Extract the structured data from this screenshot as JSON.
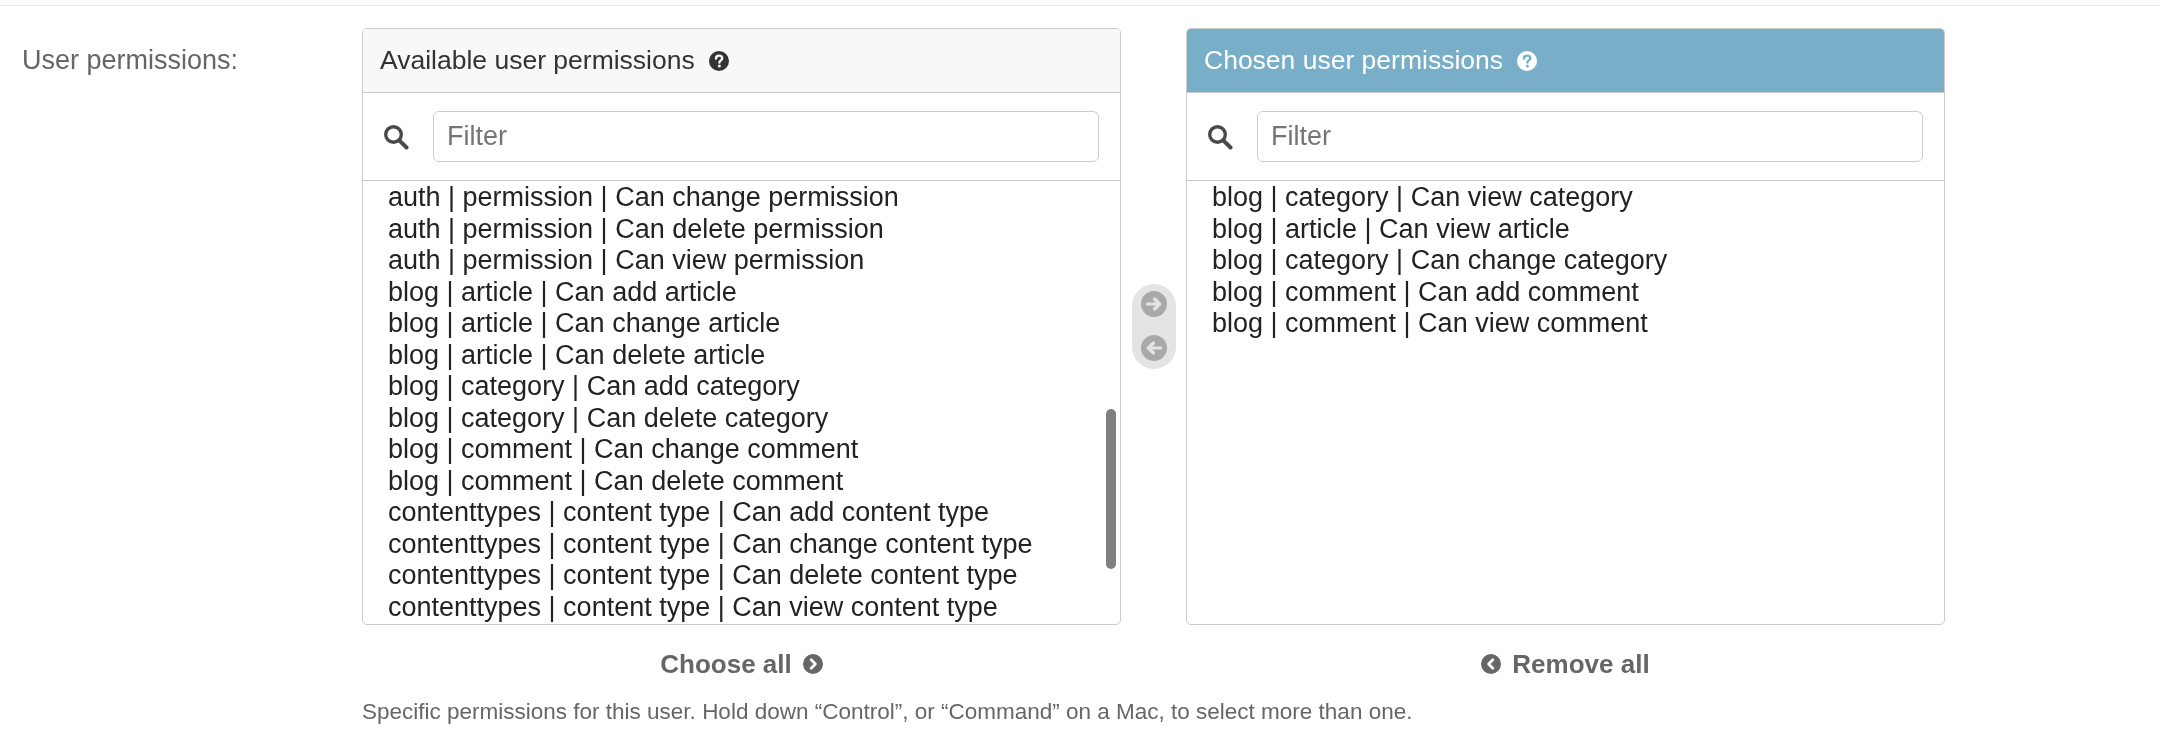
{
  "field_label": "User permissions:",
  "panels": [
    {
      "kind": "available",
      "title": "Available user permissions",
      "filter": {
        "placeholder": "Filter"
      },
      "options": [
        {
          "label": "auth | permission | Can change permission",
          "selected": false
        },
        {
          "label": "auth | permission | Can delete permission",
          "selected": false
        },
        {
          "label": "auth | permission | Can view permission",
          "selected": false
        },
        {
          "label": "blog | article | Can add article",
          "selected": false
        },
        {
          "label": "blog | article | Can change article",
          "selected": false
        },
        {
          "label": "blog | article | Can delete article",
          "selected": false
        },
        {
          "label": "blog | category | Can add category",
          "selected": false
        },
        {
          "label": "blog | category | Can delete category",
          "selected": false
        },
        {
          "label": "blog | comment | Can change comment",
          "selected": false
        },
        {
          "label": "blog | comment | Can delete comment",
          "selected": false
        },
        {
          "label": "contenttypes | content type | Can add content type",
          "selected": false
        },
        {
          "label": "contenttypes | content type | Can change content type",
          "selected": false
        },
        {
          "label": "contenttypes | content type | Can delete content type",
          "selected": false
        },
        {
          "label": "contenttypes | content type | Can view content type",
          "selected": false
        }
      ],
      "action": "Choose all"
    },
    {
      "kind": "chosen",
      "title": "Chosen user permissions",
      "filter": {
        "placeholder": "Filter"
      },
      "options": [
        {
          "label": "blog | category | Can view category",
          "selected": false
        },
        {
          "label": "blog | article | Can view article",
          "selected": false
        },
        {
          "label": "blog | category | Can change category",
          "selected": false
        },
        {
          "label": "blog | comment | Can add comment",
          "selected": false
        },
        {
          "label": "blog | comment | Can view comment",
          "selected": false
        }
      ],
      "action": "Remove all"
    }
  ],
  "move_buttons": [
    {
      "kind": "add",
      "disabled": true
    },
    {
      "kind": "remove",
      "disabled": true
    }
  ],
  "help_text": "Specific permissions for this user. Hold down “Control”, or “Command” on a Mac, to select more than one."
}
